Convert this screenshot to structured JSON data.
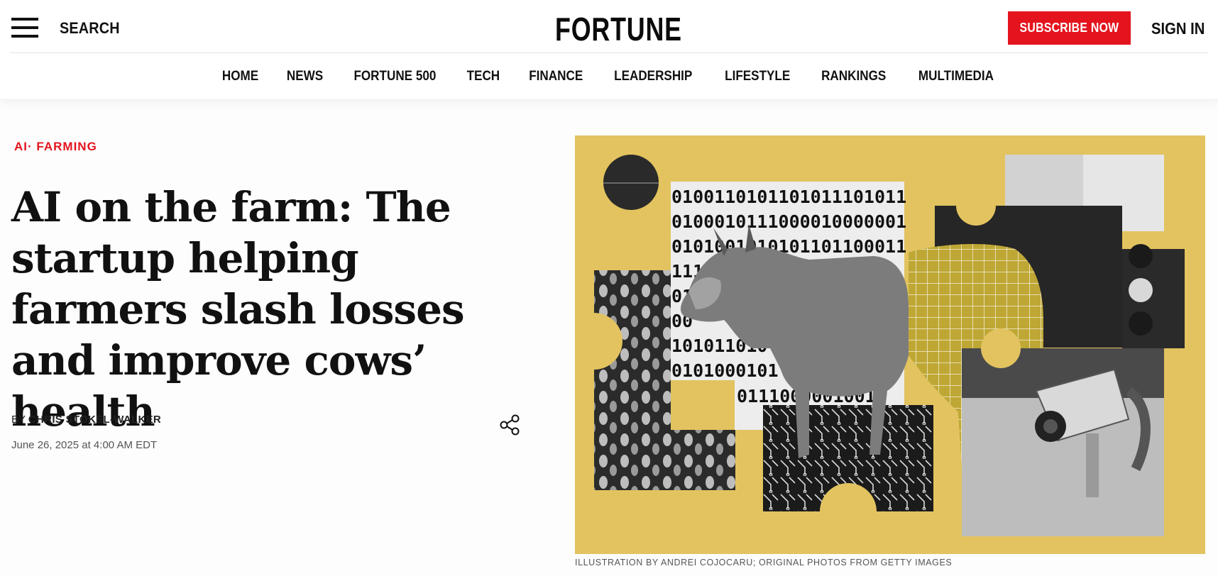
{
  "header": {
    "search_label": "SEARCH",
    "logo": "FORTUNE",
    "subscribe_label": "SUBSCRIBE NOW",
    "signin_label": "SIGN IN"
  },
  "nav": {
    "items": [
      "HOME",
      "NEWS",
      "FORTUNE 500",
      "TECH",
      "FINANCE",
      "LEADERSHIP",
      "LIFESTYLE",
      "RANKINGS",
      "MULTIMEDIA"
    ]
  },
  "article": {
    "kicker_1": "AI",
    "kicker_sep": "·",
    "kicker_2": "FARMING",
    "headline": "AI on the farm: The startup helping farmers slash losses and improve cows’ health",
    "by_prefix": "BY",
    "author": "CHRIS STOKEL-WALKER",
    "date": "June 26, 2025 at 4:00 AM EDT",
    "image_caption": "ILLUSTRATION BY ANDREI COJOCARU; ORIGINAL PHOTOS FROM GETTY IMAGES",
    "binary_lines": [
      "0100110101101011101011",
      "0100010111000010000001",
      "0101001010101101100011",
      "111",
      "011",
      "00",
      "101011010",
      "0101000101",
      "0111000001001"
    ]
  },
  "colors": {
    "brand_red": "#e3141e",
    "hero_yellow": "#e2c35f"
  },
  "icons": [
    "hamburger-menu-icon",
    "share-icon"
  ]
}
